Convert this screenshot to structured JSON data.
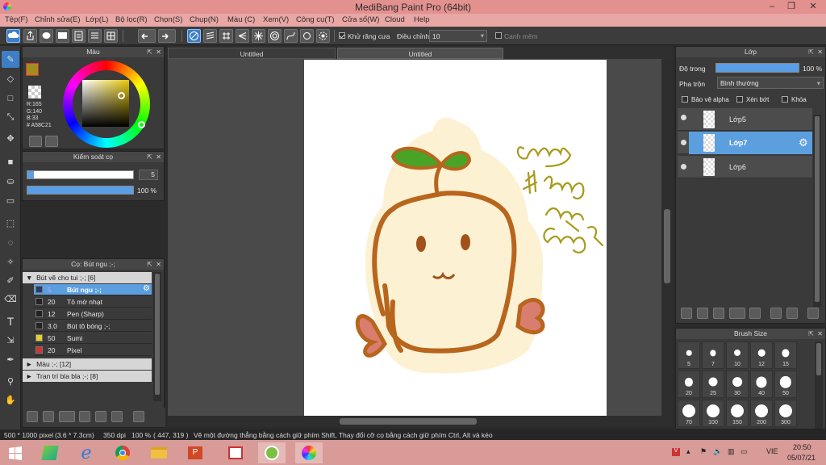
{
  "app": {
    "title": "MediBang Paint Pro (64bit)"
  },
  "menu": [
    "Tệp(F)",
    "Chỉnh sửa(E)",
    "Lớp(L)",
    "Bộ lọc(R)",
    "Chọn(S)",
    "Chụp(N)",
    "Màu (C)",
    "Xem(V)",
    "Công cụ(T)",
    "Cửa sổ(W)",
    "Cloud",
    "Help"
  ],
  "toolbar": {
    "antialias_label": "Khử răng cưa",
    "correction_label": "Điều chỉnh",
    "correction_value": "10",
    "snap_label": "Canh mêm"
  },
  "color_panel": {
    "title": "Màu",
    "r": "R:165",
    "g": "G:140",
    "b": "B:33",
    "hex": "# A58C21",
    "main_color": "#a58c21"
  },
  "brush_control": {
    "title": "Kiểm soát cọ",
    "size": "5",
    "opacity": "100 %",
    "size_fraction": 0.06,
    "opacity_fraction": 1.0
  },
  "brush_panel": {
    "title": "Cọ: Bút ngu ;-;",
    "group1": "Bút vẽ cho tui ;-; [6]",
    "brushes": [
      {
        "size": "5",
        "name": "Bút ngu ;-;",
        "color": "#2a3a6a"
      },
      {
        "size": "20",
        "name": "Tô mờ nhạt",
        "color": "#222222"
      },
      {
        "size": "12",
        "name": "Pen (Sharp)",
        "color": "#222222"
      },
      {
        "size": "3.0",
        "name": "Bút tô bóng ;-;",
        "color": "#222222"
      },
      {
        "size": "50",
        "name": "Sumi",
        "color": "#e8d02a"
      },
      {
        "size": "20",
        "name": "Pixel",
        "color": "#d33333"
      }
    ],
    "group2": "Màu ;-; [12]",
    "group3": "Tran trí bla bla ;-; [8]"
  },
  "tabs": [
    "Untitled",
    "Untitled"
  ],
  "layer_panel": {
    "title": "Lớp",
    "opacity_label": "Độ trong",
    "opacity_value": "100 %",
    "opacity_fraction": 1.0,
    "blend_label": "Pha trộn",
    "blend_value": "Bình thường",
    "protect_alpha": "Bảo vệ alpha",
    "clipping": "Xén bớt",
    "lock": "Khóa",
    "layers": [
      "Lớp5",
      "Lớp7",
      "Lớp6"
    ]
  },
  "brush_size_panel": {
    "title": "Brush Size",
    "sizes": [
      "5",
      "7",
      "10",
      "12",
      "15",
      "20",
      "25",
      "30",
      "40",
      "50",
      "70",
      "100",
      "150",
      "200",
      "300"
    ]
  },
  "status_bar": {
    "canvas_size": "500 * 1000 pixel",
    "physical_size": "(3.6 * 7.3cm)",
    "dpi": "350 dpi",
    "zoom": "100 %",
    "cursor": "( 447, 319 )",
    "hint": "Vẽ một đường thẳng bằng cách giữ phím Shift, Thay đổi cỡ cọ bằng cách giữ phím Ctrl, Alt và kéo"
  },
  "taskbar": {
    "lang": "VIE",
    "time": "20:50",
    "date": "05/07/21"
  },
  "drawing_text": {
    "line1": "Chug",
    "line2": "# đổi dạp",
    "line3": "xinh",
    "line4": "Chug 2k"
  }
}
